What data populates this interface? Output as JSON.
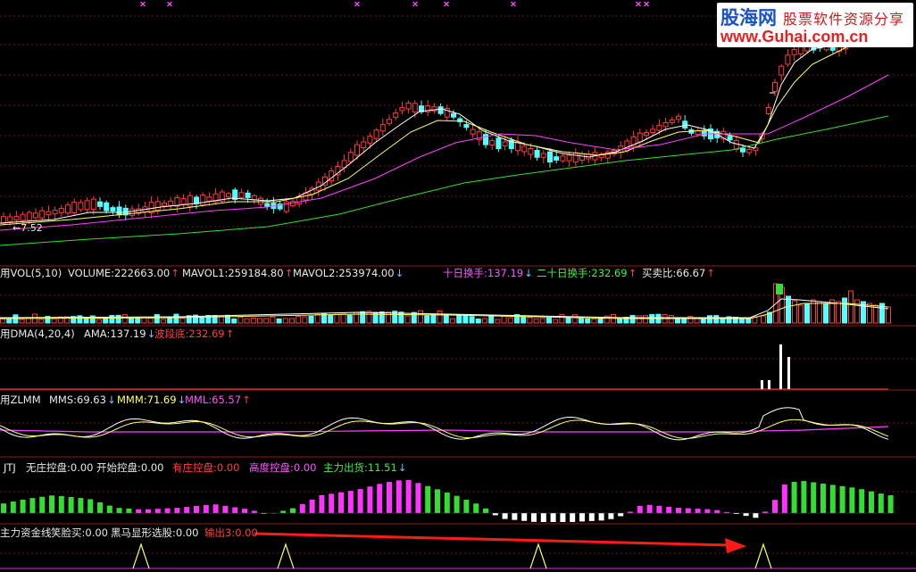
{
  "logo": {
    "brand": "股海网",
    "slogan": "股票软件资源分享",
    "url": "www.Guhai.com.cn"
  },
  "price_panel": {
    "low_label": "←7.52"
  },
  "vol_panel": {
    "name": "用VOL(5,10)",
    "volume": "VOLUME:222663.00",
    "volume_arrow": "↑",
    "mavol1": "MAVOL1:259184.80",
    "mavol1_arrow": "↑",
    "mavol2": "MAVOL2:253974.00",
    "mavol2_arrow": "↓",
    "turnover10": "十日换手:137.19",
    "turnover10_arrow": "↓",
    "turnover20": "二十日换手:232.69",
    "turnover20_arrow": "↑",
    "ratio": "买卖比:66.67",
    "ratio_arrow": "↑"
  },
  "dma_panel": {
    "name": "用DMA(4,20,4)",
    "ama": "AMA:137.19",
    "ama_arrow": "↓",
    "bottom": "波段底:232.69",
    "bottom_arrow": "↑"
  },
  "zlmm_panel": {
    "name": "用ZLMM",
    "mms": "MMS:69.63",
    "mms_arrow": "↓",
    "mmm": "MMM:71.69",
    "mmm_arrow": "↓",
    "mml": "MML:65.57",
    "mml_arrow": "↑"
  },
  "jtj_panel": {
    "name": "JTJ",
    "none": "无庄控盘:0.00",
    "start": "开始控盘:0.00",
    "has": "有庄控盘:0.00",
    "high": "高度控盘:0.00",
    "out": "主力出货:11.51",
    "out_arrow": "↓"
  },
  "fund_panel": {
    "name": "主力资金线",
    "smile": "笑脸买:0.00",
    "horse": "黑马显形选股:0.00",
    "out": "输出3:0.00"
  },
  "colors": {
    "grid": "#8a1a1a",
    "up": "#ff3a3a",
    "down": "#54ffff",
    "ma_white": "#ffffff",
    "ma_yellow": "#ffff66",
    "ma_magenta": "#ff40ff",
    "ma_green": "#33dd33",
    "marker": "#ff40ff"
  },
  "icons": {
    "top_markers": "x-marker-icon",
    "trend_arrow": "red-arrow-icon"
  }
}
